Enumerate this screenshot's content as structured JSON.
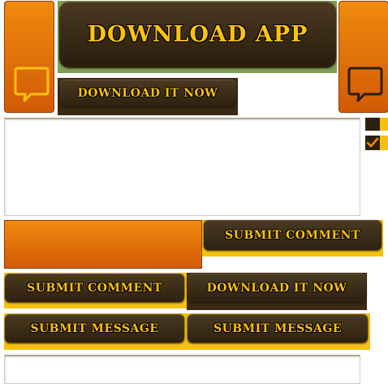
{
  "sprites": {
    "download_app_label": "DOWNLOAD APP",
    "download_now_label_1": "DOWNLOAD IT NOW",
    "download_now_label_2": "DOWNLOAD IT NOW",
    "submit_comment_label_1": "SUBMIT COMMENT",
    "submit_comment_label_2": "SUBMIT COMMENT",
    "submit_message_label_1": "SUBMIT MESSAGE",
    "submit_message_label_2": "SUBMIT MESSAGE"
  },
  "icons": {
    "left_tab_icon": "speech-bubble-icon",
    "right_tab_icon": "speech-bubble-icon",
    "checkbox_checked_icon": "checkmark-icon"
  },
  "colors": {
    "accent_yellow": "#ffc20e",
    "button_brown": "#3a2a14",
    "tab_orange": "#e57309",
    "green_backdrop": "#7f9e52"
  },
  "checkboxes": {
    "unchecked": false,
    "checked": true
  }
}
